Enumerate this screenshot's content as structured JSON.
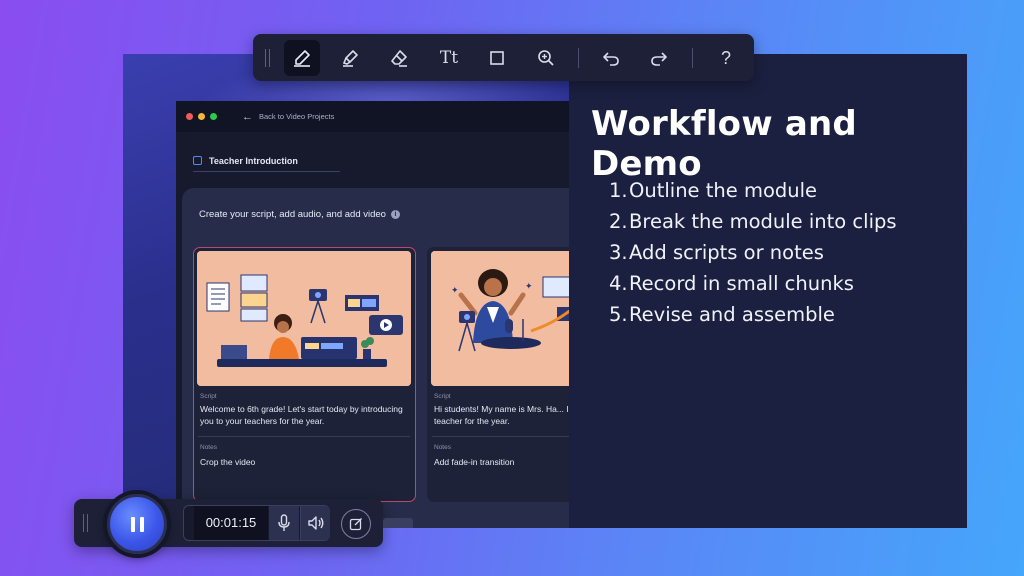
{
  "toolbar": {
    "tools": [
      {
        "id": "pen",
        "icon": "pen-icon",
        "active": true
      },
      {
        "id": "highlighter",
        "icon": "highlighter-icon",
        "active": false
      },
      {
        "id": "eraser",
        "icon": "eraser-icon",
        "active": false
      },
      {
        "id": "text",
        "icon": "text-icon",
        "label": "Tt",
        "active": false
      },
      {
        "id": "shape",
        "icon": "rectangle-icon",
        "active": false
      },
      {
        "id": "zoom",
        "icon": "zoom-in-icon",
        "active": false
      },
      {
        "id": "undo",
        "icon": "undo-icon",
        "active": false
      },
      {
        "id": "redo",
        "icon": "redo-icon",
        "active": false
      },
      {
        "id": "help",
        "icon": "help-icon",
        "label": "?",
        "active": false
      }
    ]
  },
  "app": {
    "back_link": "Back to Video Projects",
    "project_title": "Teacher Introduction",
    "section_heading": "Create your script, add audio, and add video",
    "clips": [
      {
        "script_label": "Script",
        "script": "Welcome to 6th grade! Let's start today by introducing you to your teachers for the year.",
        "notes_label": "Notes",
        "notes": "Crop the video",
        "selected": true
      },
      {
        "script_label": "Script",
        "script": "Hi students! My name is Mrs. Ha... I'm your math teacher for the year.",
        "notes_label": "Notes",
        "notes": "Add fade-in transition",
        "selected": false
      }
    ]
  },
  "slide": {
    "title": "Workflow and Demo",
    "items": [
      {
        "num": "1.",
        "text": "Outline the module"
      },
      {
        "num": "2.",
        "text": "Break the module into clips"
      },
      {
        "num": "3.",
        "text": "Add scripts or notes"
      },
      {
        "num": "4.",
        "text": "Record in small chunks"
      },
      {
        "num": "5.",
        "text": "Revise and assemble"
      }
    ]
  },
  "recorder": {
    "timer": "00:01:15",
    "state_icon": "pause-icon",
    "mic_icon": "microphone-icon",
    "speaker_icon": "speaker-icon",
    "annotate_icon": "annotate-icon"
  },
  "colors": {
    "accent": "#4f8bff",
    "selected_border": "#b94a6e",
    "slide_bg": "#1b2040",
    "record_button": "#3b56e8"
  }
}
